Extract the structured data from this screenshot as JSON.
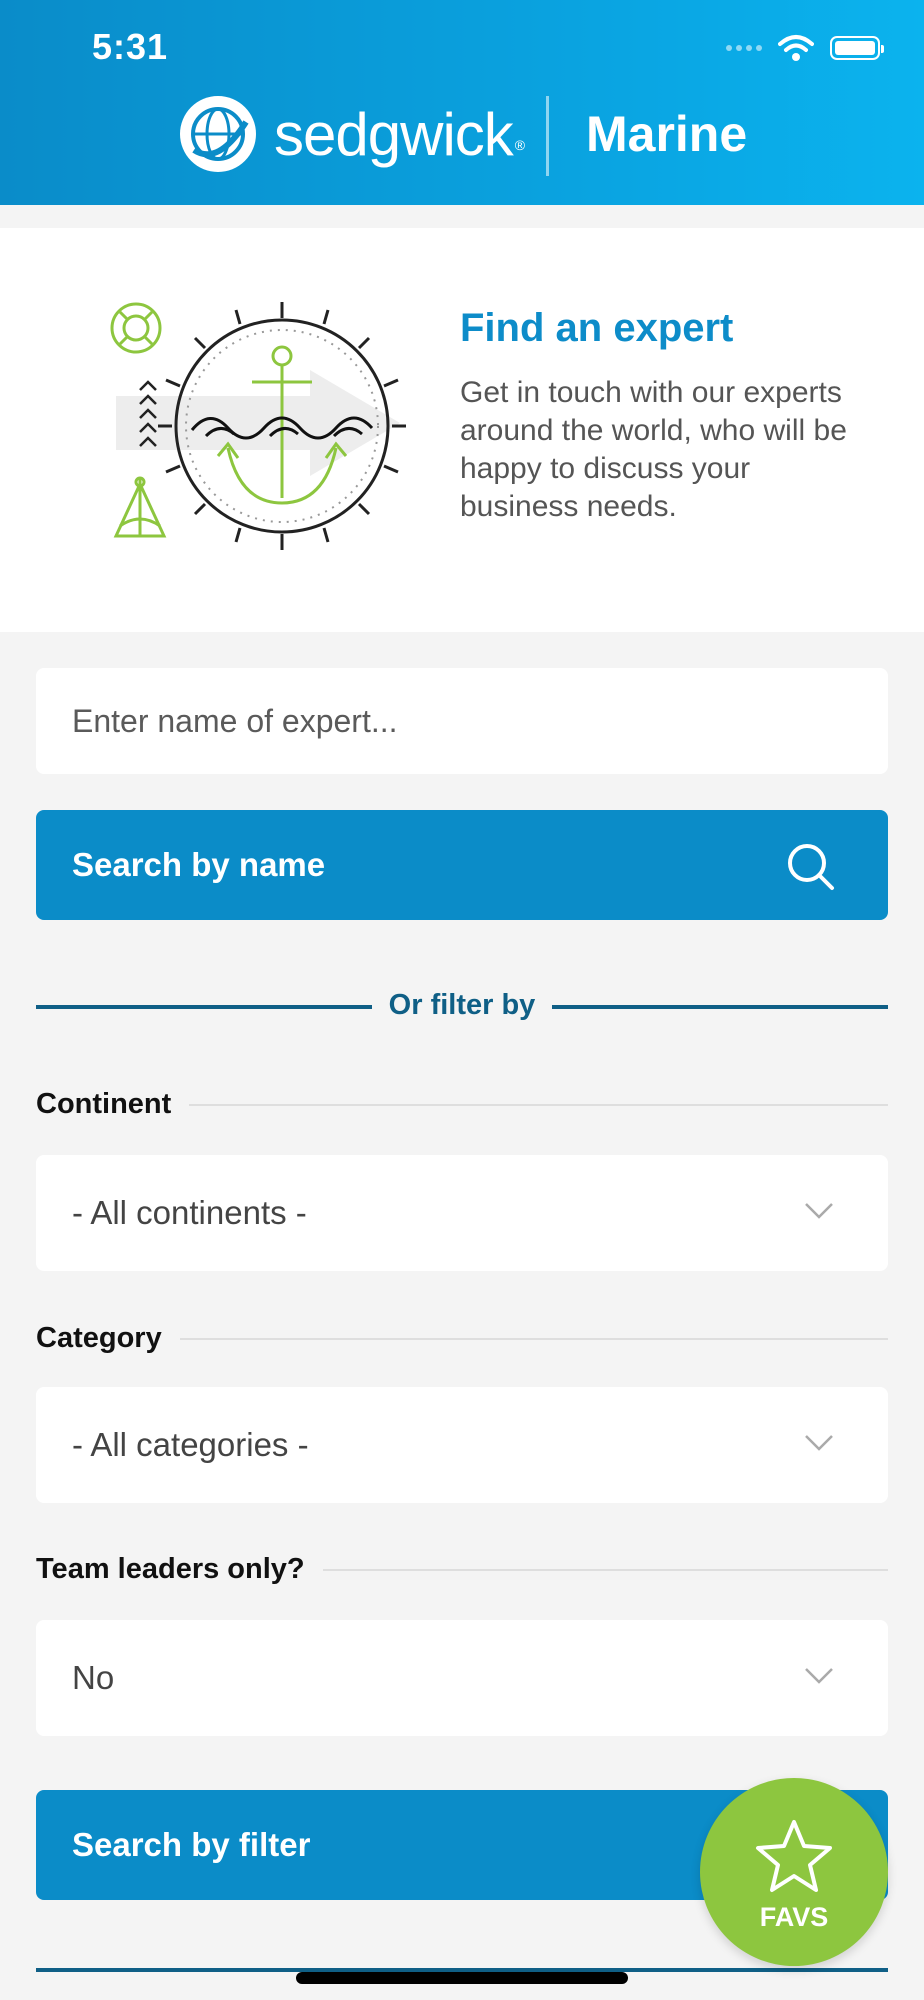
{
  "status_bar": {
    "time": "5:31"
  },
  "header": {
    "brand": "sedgwick",
    "registered": "®",
    "section": "Marine"
  },
  "intro": {
    "title": "Find an expert",
    "text": "Get in touch with our experts around the world, who will be happy to discuss your business needs.",
    "illustration": "anchor-compass-illustration"
  },
  "search": {
    "placeholder": "Enter name of expert...",
    "button_label": "Search by name"
  },
  "filter": {
    "divider_label": "Or filter by",
    "continent": {
      "label": "Continent",
      "value": "- All continents -"
    },
    "category": {
      "label": "Category",
      "value": "- All categories -"
    },
    "team_leaders": {
      "label": "Team leaders only?",
      "value": "No"
    },
    "button_label": "Search by filter"
  },
  "fab": {
    "label": "FAVS",
    "icon": "star-icon"
  },
  "colors": {
    "primary": "#0b8cc8",
    "dark_accent": "#0f5f86",
    "favs_green": "#8dc63f",
    "background": "#f4f4f4"
  }
}
